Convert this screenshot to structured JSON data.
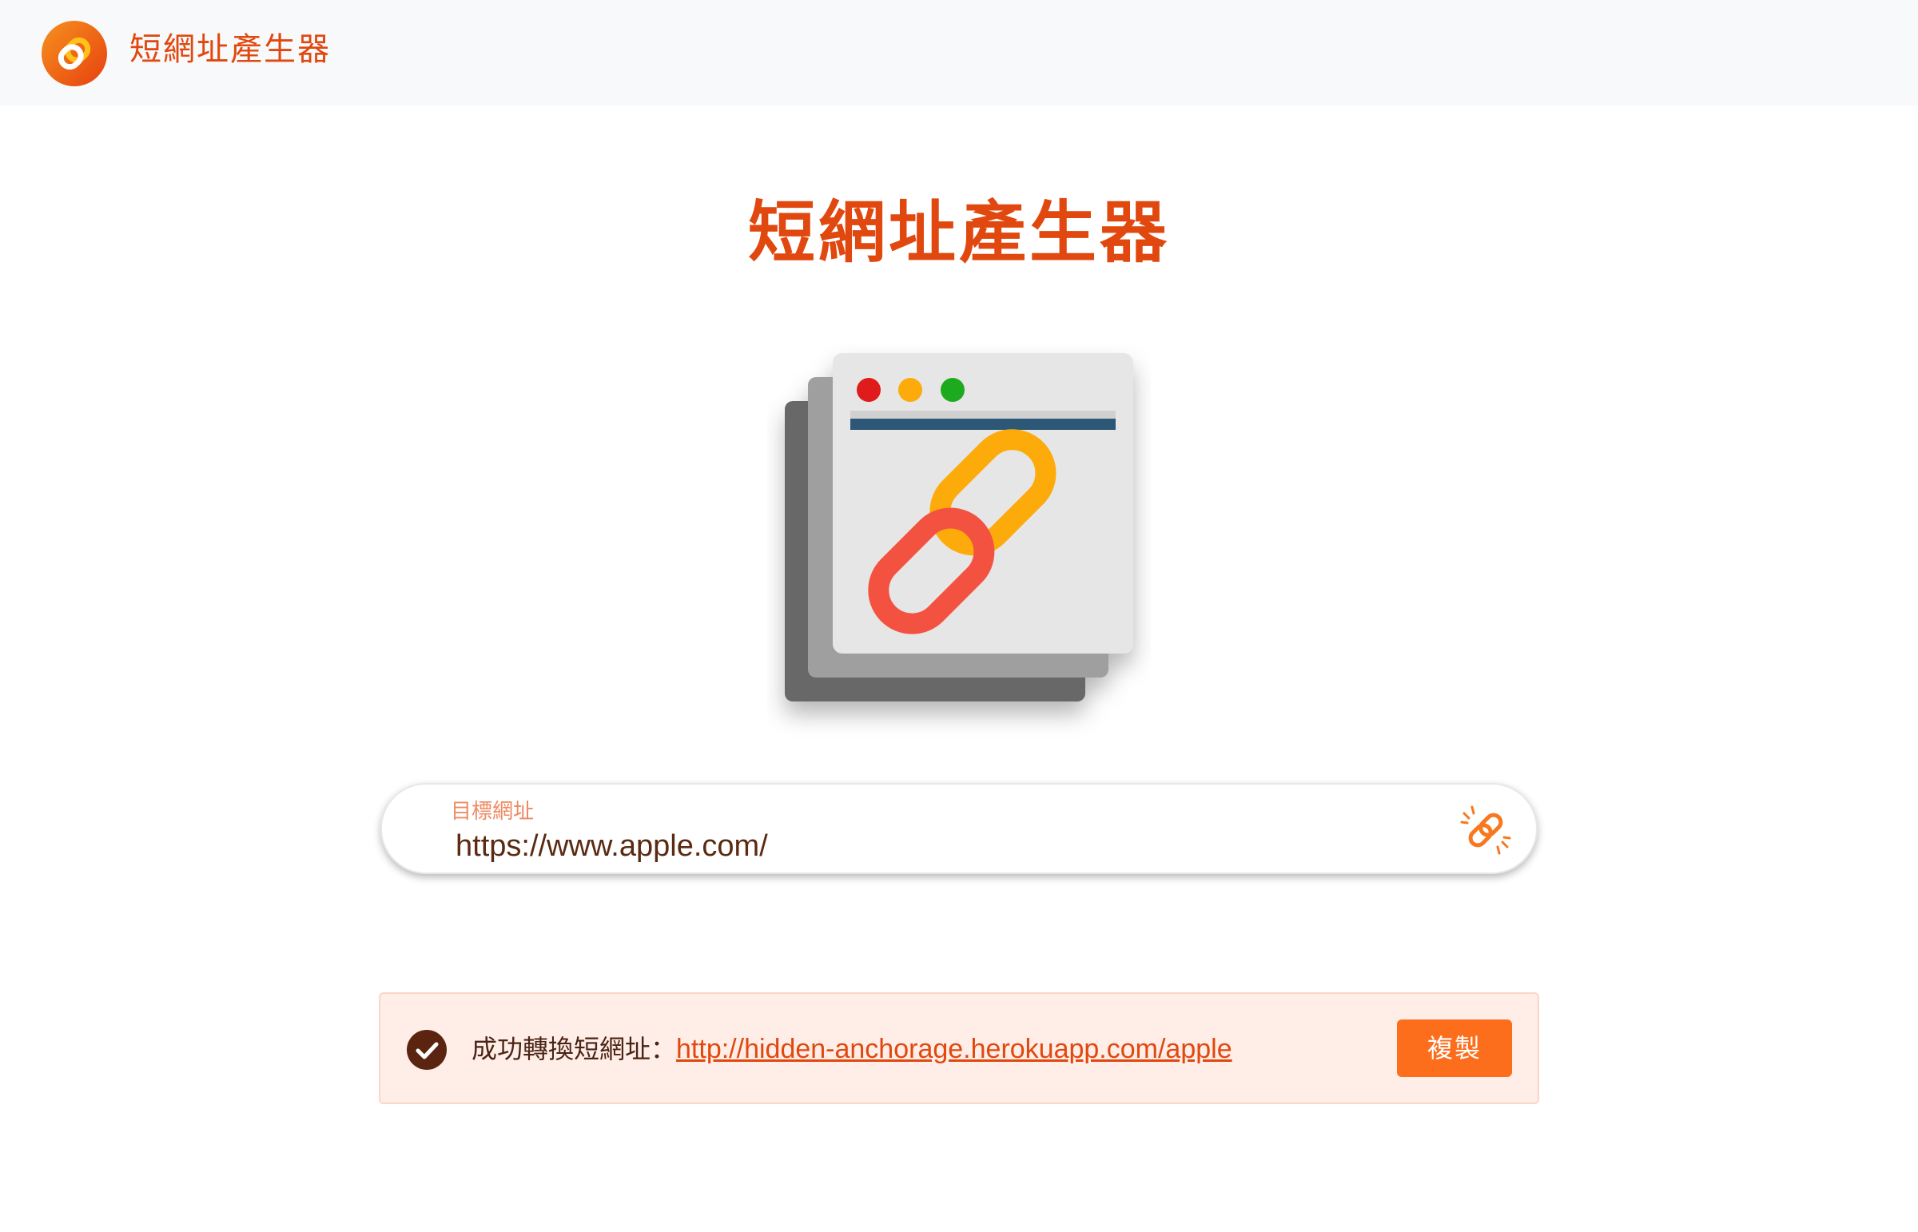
{
  "navbar": {
    "logo_icon": "chain-link-logo-icon",
    "brand": "短網址產生器"
  },
  "main": {
    "title": "短網址產生器",
    "hero_icon": "browser-windows-link-illustration"
  },
  "form": {
    "label": "目標網址",
    "url_value": "https://www.apple.com/",
    "submit_icon": "broken-link-icon"
  },
  "result": {
    "status_icon": "check-circle-icon",
    "message": "成功轉換短網址：",
    "short_url": "http://hidden-anchorage.herokuapp.com/apple",
    "copy_label": "複製"
  },
  "colors": {
    "brand": "#e1480f",
    "button": "#fd6e1c",
    "alert_bg": "#ffeee8",
    "navbar_bg": "#f8f9fa"
  }
}
